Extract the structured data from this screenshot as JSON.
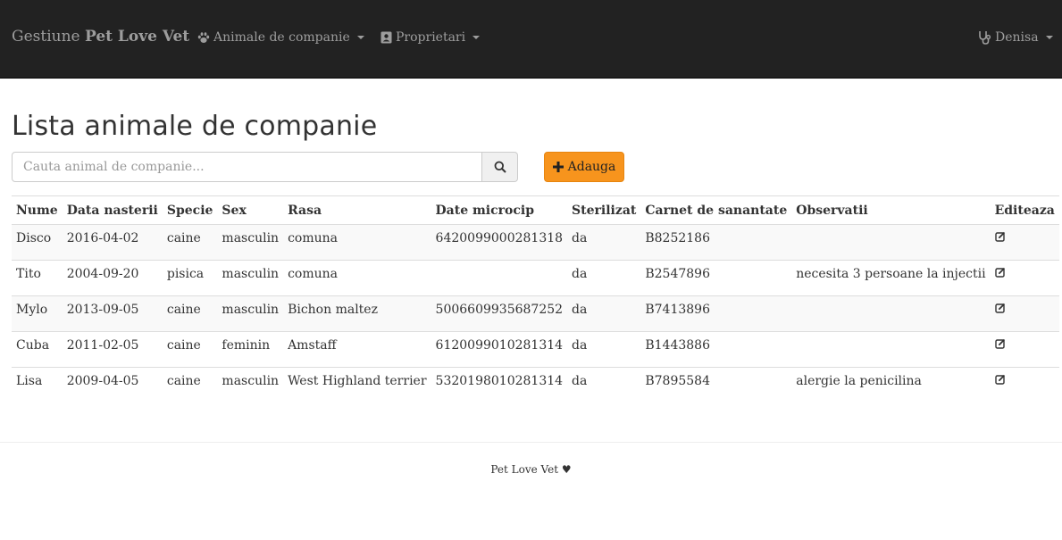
{
  "navbar": {
    "brand_prefix": "Gestiune",
    "brand_name": "Pet Love Vet",
    "menu_pets": "Animale de companie",
    "menu_owners": "Proprietari",
    "user": "Denisa"
  },
  "page": {
    "title": "Lista animale de companie",
    "search_placeholder": "Cauta animal de companie...",
    "add_label": "Adauga"
  },
  "table": {
    "headers": [
      "Nume",
      "Data nasterii",
      "Specie",
      "Sex",
      "Rasa",
      "Date microcip",
      "Sterilizat",
      "Carnet de sanantate",
      "Observatii",
      "Editeaza"
    ],
    "rows": [
      [
        "Disco",
        "2016-04-02",
        "caine",
        "masculin",
        "comuna",
        "6420099000281318",
        "da",
        "B8252186",
        ""
      ],
      [
        "Tito",
        "2004-09-20",
        "pisica",
        "masculin",
        "comuna",
        "",
        "da",
        "B2547896",
        "necesita 3 persoane la injectii"
      ],
      [
        "Mylo",
        "2013-09-05",
        "caine",
        "masculin",
        "Bichon maltez",
        "5006609935687252",
        "da",
        "B7413896",
        ""
      ],
      [
        "Cuba",
        "2011-02-05",
        "caine",
        "feminin",
        "Amstaff",
        "6120099010281314",
        "da",
        "B1443886",
        ""
      ],
      [
        "Lisa",
        "2009-04-05",
        "caine",
        "masculin",
        "West Highland terrier",
        "5320198010281314",
        "da",
        "B7895584",
        "alergie la penicilina"
      ]
    ]
  },
  "footer": {
    "text": "Pet Love Vet ♥"
  },
  "icons": {
    "pets_menu": "paw-icon",
    "owners_menu": "contact-card-icon",
    "user_menu": "stethoscope-icon",
    "search": "search-icon",
    "add": "plus-icon",
    "edit": "edit-icon"
  },
  "colors": {
    "navbar": "#222222",
    "accent": "#f7941d"
  }
}
